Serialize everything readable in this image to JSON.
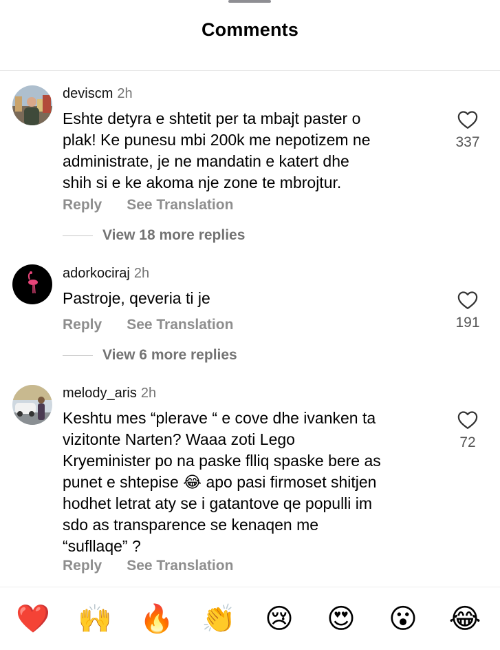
{
  "header": {
    "title": "Comments"
  },
  "comments": [
    {
      "username": "deviscm",
      "time": "2h",
      "lines": [
        "Eshte detyra e shtetit per ta mbajt paster o",
        "plak! Ke punesu mbi 200k me nepotizem ne",
        "administrate, je ne mandatin e katert dhe",
        "shih si e ke akoma nje zone te mbrojtur."
      ],
      "likes": "337",
      "reply_label": "Reply",
      "translate_label": "See Translation",
      "replies_label": "View 18 more replies"
    },
    {
      "username": "adorkociraj",
      "time": "2h",
      "lines": [
        "Pastroje, qeveria ti je"
      ],
      "likes": "191",
      "reply_label": "Reply",
      "translate_label": "See Translation",
      "replies_label": "View 6 more replies"
    },
    {
      "username": "melody_aris",
      "time": "2h",
      "lines": [
        "Keshtu mes “plerave “ e cove dhe ivanken ta",
        "vizitonte Narten?  Waaa zoti Lego",
        "Kryeminister po na paske flliq spaske bere as",
        "punet e shtepise 😂 apo pasi firmoset shitjen",
        "hodhet letrat aty se i gatantove qe populli im",
        "sdo as transparence se kenaqen me",
        "“sufllaqe” ?"
      ],
      "likes": "72",
      "reply_label": "Reply",
      "translate_label": "See Translation"
    }
  ],
  "reactions": [
    "❤️",
    "🙌",
    "🔥",
    "👏",
    "😢",
    "😍",
    "😮",
    "😂"
  ],
  "icons": {
    "like": "heart-outline-icon"
  },
  "colors": {
    "secondary_text": "#8e8e8e",
    "divider": "#e6e6e6"
  }
}
